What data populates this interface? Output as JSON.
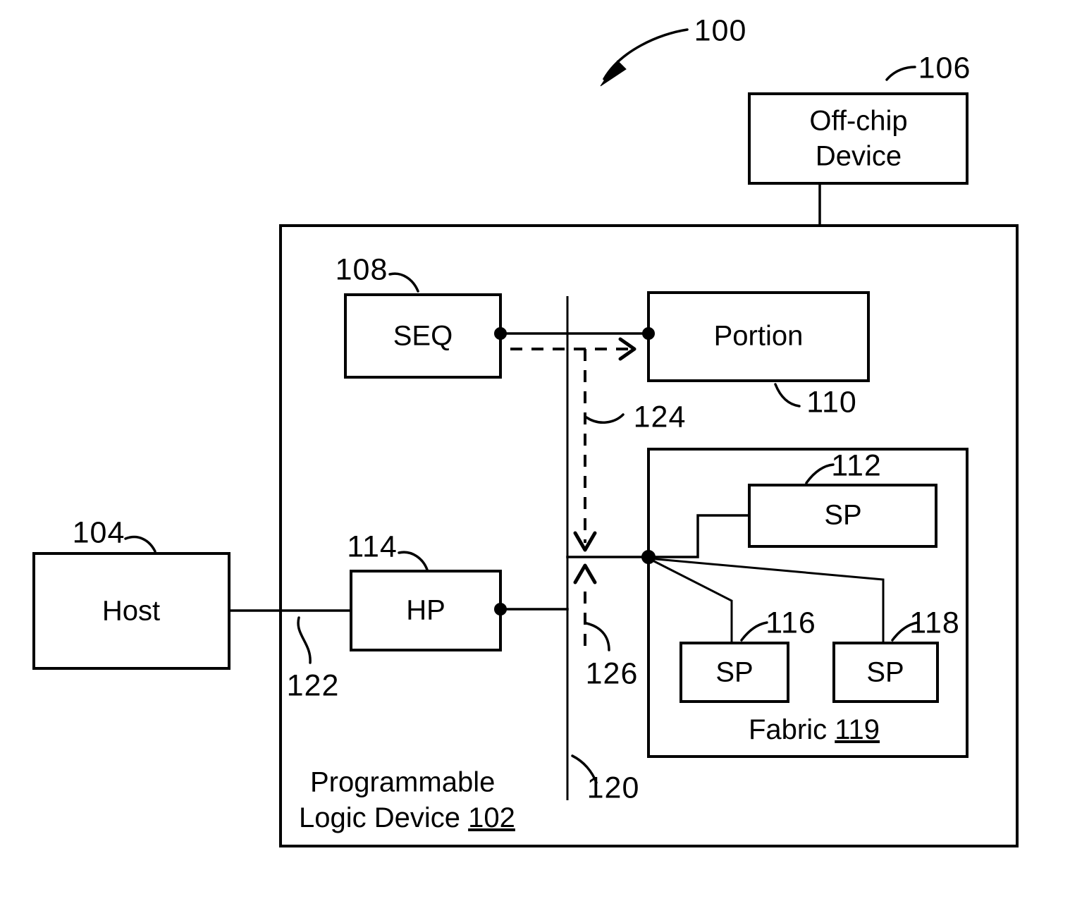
{
  "figure": {
    "number": "100",
    "title_ref": "100"
  },
  "blocks": {
    "off_chip_device": {
      "label_line1": "Off-chip",
      "label_line2": "Device",
      "ref": "106"
    },
    "seq": {
      "label": "SEQ",
      "ref": "108"
    },
    "portion": {
      "label": "Portion",
      "ref": "110"
    },
    "host": {
      "label": "Host",
      "ref": "104"
    },
    "hp": {
      "label": "HP",
      "ref": "114"
    },
    "sp_top": {
      "label": "SP",
      "ref": "112"
    },
    "sp_left": {
      "label": "SP",
      "ref": "116"
    },
    "sp_right": {
      "label": "SP",
      "ref": "118"
    }
  },
  "regions": {
    "pld": {
      "label_line1": "Programmable",
      "label_line2_text": "Logic Device ",
      "label_line2_ref": "102"
    },
    "fabric": {
      "label_text": "Fabric ",
      "label_ref": "119"
    }
  },
  "connections": {
    "host_to_hp": {
      "ref": "122"
    },
    "boundary_line": {
      "ref": "120"
    },
    "downstream_dashed": {
      "ref": "124"
    },
    "upstream_dashed": {
      "ref": "126"
    }
  },
  "colors": {
    "ink": "#000000",
    "paper": "#ffffff"
  }
}
